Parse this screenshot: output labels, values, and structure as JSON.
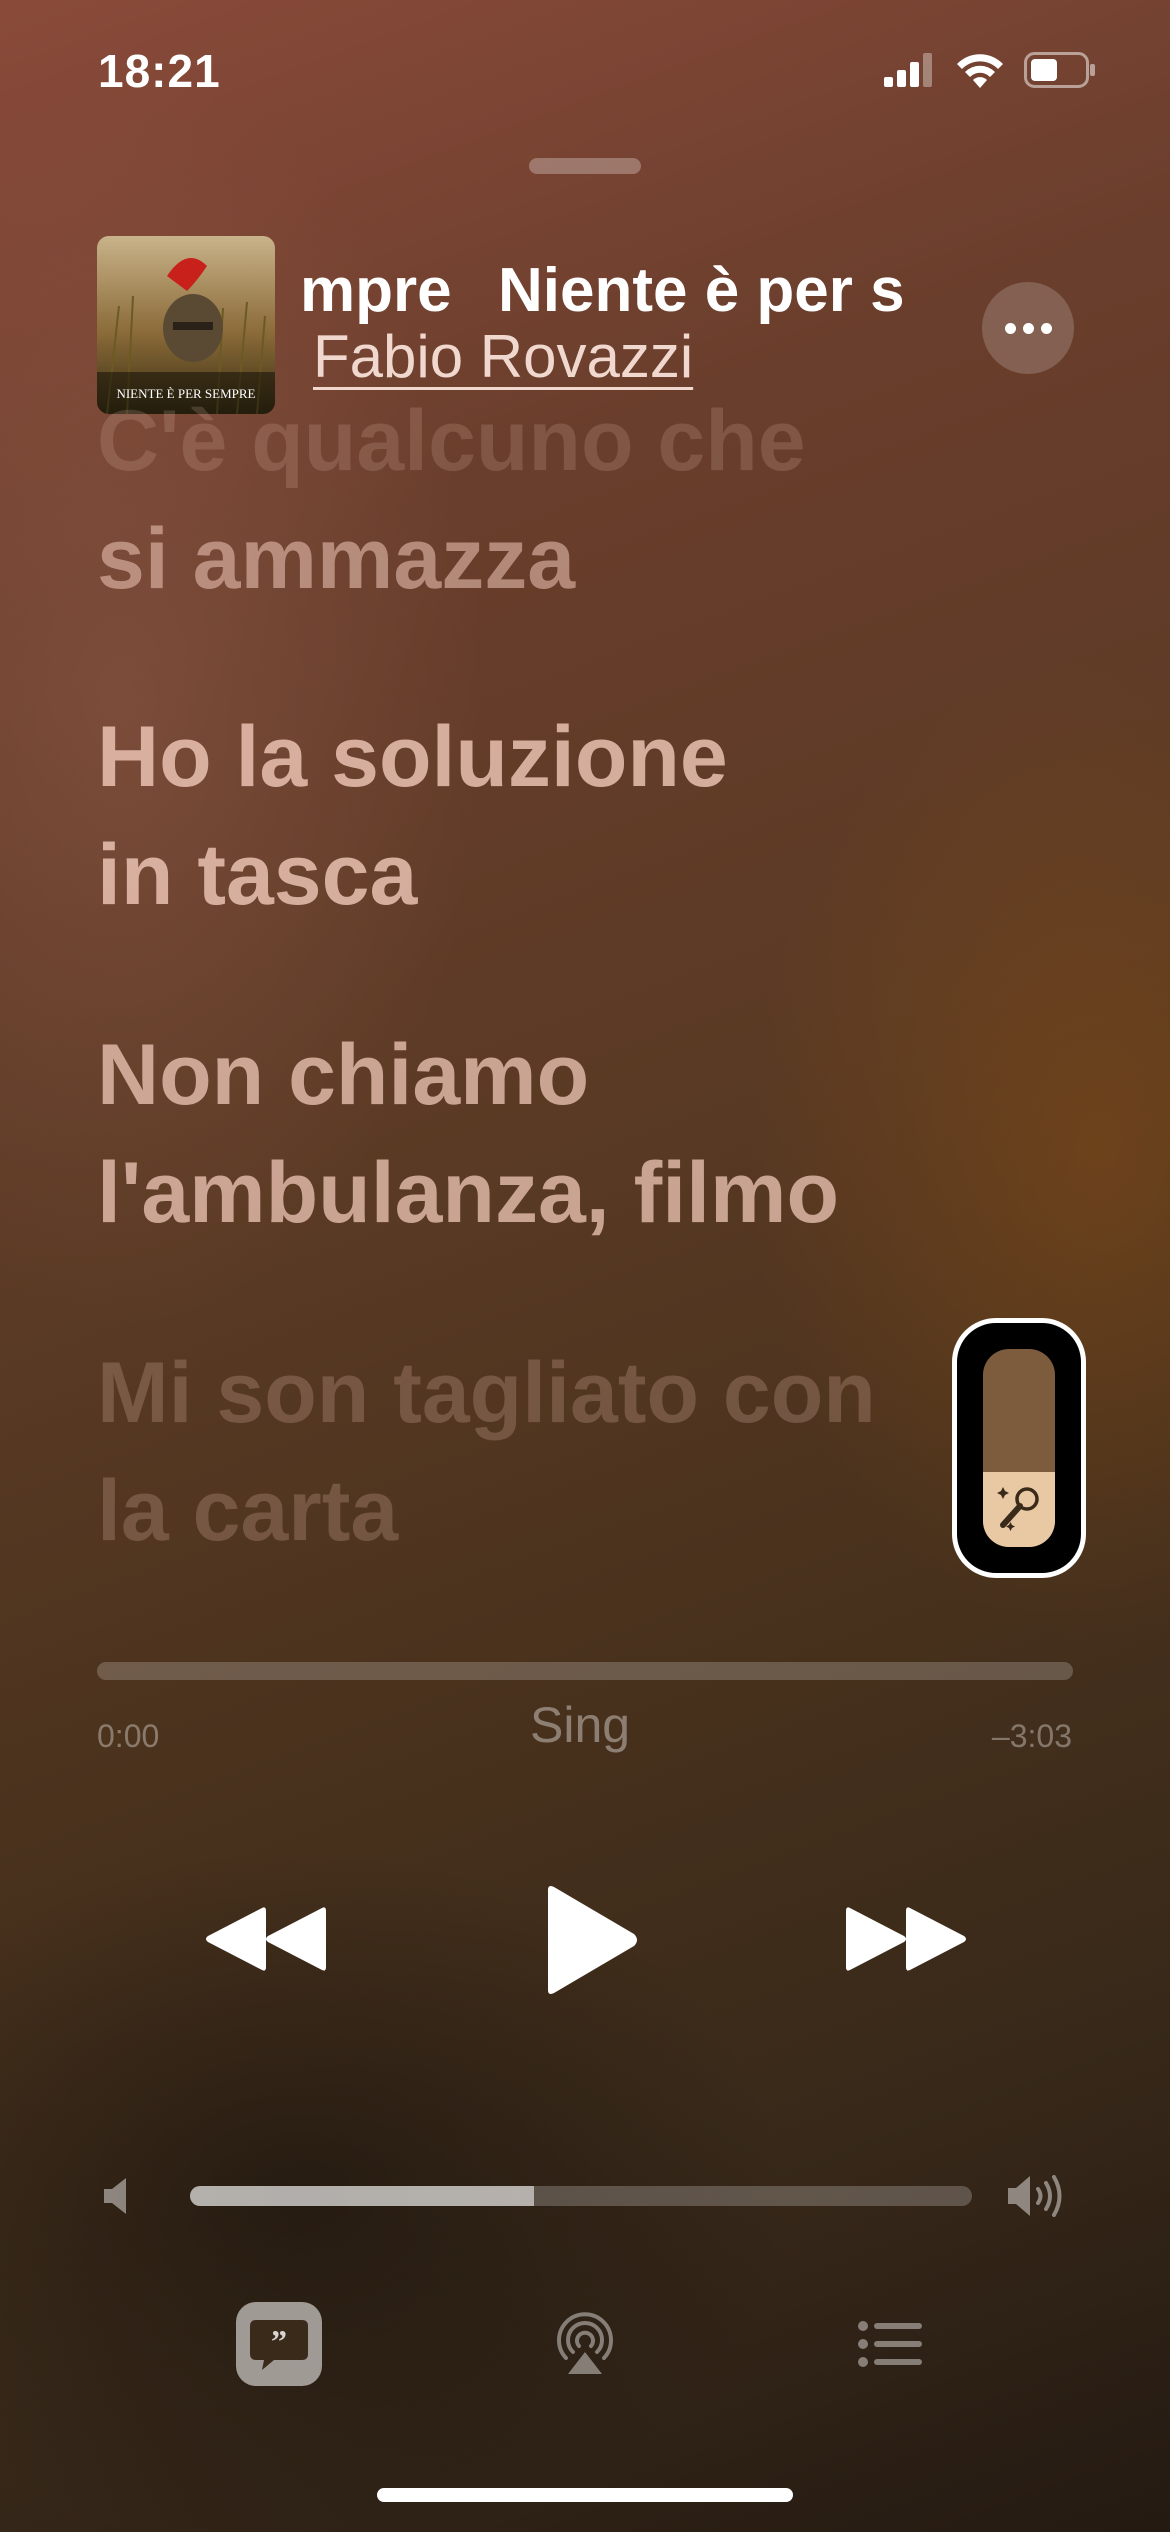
{
  "status_bar": {
    "time": "18:21"
  },
  "now_playing": {
    "title_fragment": "mpre",
    "title": "Niente è per s",
    "artist": "Fabio Rovazzi",
    "album_art_text": "NIENTE È PER SEMPRE"
  },
  "lyrics": [
    {
      "text": "C'è qualcuno che",
      "state": "past"
    },
    {
      "text": "si ammazza",
      "state": "past"
    },
    {
      "text": "Ho la soluzione",
      "state": "current"
    },
    {
      "text": "in tasca",
      "state": "current"
    },
    {
      "text": "Non chiamo",
      "state": "current"
    },
    {
      "text": "l'ambulanza, filmo",
      "state": "current"
    },
    {
      "text": "Mi son tagliato con",
      "state": "upcoming"
    },
    {
      "text": "la carta",
      "state": "upcoming"
    }
  ],
  "playback": {
    "elapsed": "0:00",
    "remaining": "–3:03",
    "progress": 0.0,
    "sing_label": "Sing",
    "vocal_level": 0.38
  },
  "volume": {
    "level": 0.44
  },
  "icons": {
    "more": "ellipsis-icon",
    "rewind": "backward-icon",
    "play": "play-icon",
    "forward": "forward-icon",
    "lyrics": "quote-bubble-icon",
    "airplay": "airplay-icon",
    "queue": "list-icon",
    "sing": "microphone-icon"
  }
}
